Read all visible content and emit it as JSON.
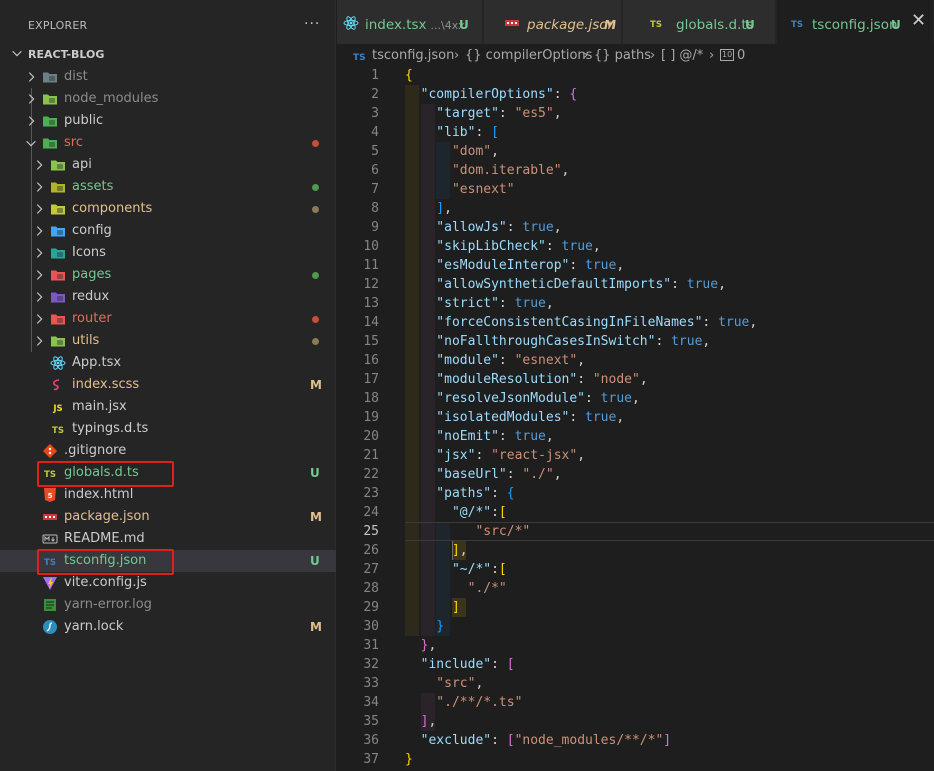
{
  "explorer": {
    "title": "EXPLORER",
    "more": "···",
    "root": "REACT-BLOG",
    "items": [
      {
        "label": "dist",
        "depth": 0,
        "type": "folder",
        "open": false,
        "icon": "dist-folder-icon",
        "icolor": "#6d8086",
        "tcolor": "#8c8c8c"
      },
      {
        "label": "node_modules",
        "depth": 0,
        "type": "folder",
        "open": false,
        "icon": "node-folder-icon",
        "icolor": "#8bc34a",
        "tcolor": "#8c8c8c"
      },
      {
        "label": "public",
        "depth": 0,
        "type": "folder",
        "open": false,
        "icon": "public-folder-icon",
        "icolor": "#4caf50",
        "tcolor": "#cccccc"
      },
      {
        "label": "src",
        "depth": 0,
        "type": "folder",
        "open": true,
        "icon": "src-folder-icon",
        "icolor": "#4caf50",
        "tcolor": "#e06c5f",
        "dot": "#c74e39"
      },
      {
        "label": "api",
        "depth": 1,
        "type": "folder",
        "open": false,
        "icon": "api-folder-icon",
        "icolor": "#8bc34a",
        "tcolor": "#cccccc"
      },
      {
        "label": "assets",
        "depth": 1,
        "type": "folder",
        "open": false,
        "icon": "assets-folder-icon",
        "icolor": "#afb42b",
        "tcolor": "#73c991",
        "dot": "#4e9a4e"
      },
      {
        "label": "components",
        "depth": 1,
        "type": "folder",
        "open": false,
        "icon": "components-folder-icon",
        "icolor": "#c0ca33",
        "tcolor": "#e2c08d",
        "dot": "#8a7a55"
      },
      {
        "label": "config",
        "depth": 1,
        "type": "folder",
        "open": false,
        "icon": "config-folder-icon",
        "icolor": "#42a5f5",
        "tcolor": "#cccccc"
      },
      {
        "label": "Icons",
        "depth": 1,
        "type": "folder",
        "open": false,
        "icon": "icons-folder-icon",
        "icolor": "#26a69a",
        "tcolor": "#cccccc"
      },
      {
        "label": "pages",
        "depth": 1,
        "type": "folder",
        "open": false,
        "icon": "pages-folder-icon",
        "icolor": "#ef5350",
        "tcolor": "#73c991",
        "dot": "#4e9a4e"
      },
      {
        "label": "redux",
        "depth": 1,
        "type": "folder",
        "open": false,
        "icon": "redux-folder-icon",
        "icolor": "#7e57c2",
        "tcolor": "#cccccc"
      },
      {
        "label": "router",
        "depth": 1,
        "type": "folder",
        "open": false,
        "icon": "router-folder-icon",
        "icolor": "#ef5350",
        "tcolor": "#e06c5f",
        "dot": "#c74e39"
      },
      {
        "label": "utils",
        "depth": 1,
        "type": "folder",
        "open": false,
        "icon": "utils-folder-icon",
        "icolor": "#8bc34a",
        "tcolor": "#e2c08d",
        "dot": "#8a7a55"
      },
      {
        "label": "App.tsx",
        "depth": 1,
        "type": "file",
        "icon": "react-icon",
        "icolor": "#61dafb",
        "tcolor": "#cccccc"
      },
      {
        "label": "index.scss",
        "depth": 1,
        "type": "file",
        "icon": "sass-icon",
        "icolor": "#ec407a",
        "tcolor": "#e2c08d",
        "badge": "M",
        "bcolor": "#e2c08d"
      },
      {
        "label": "main.jsx",
        "depth": 1,
        "type": "file",
        "icon": "js-icon",
        "text": "JS",
        "icolor": "#f5de19",
        "tcolor": "#cccccc"
      },
      {
        "label": "typings.d.ts",
        "depth": 1,
        "type": "file",
        "icon": "ts-icon",
        "text": "TS",
        "icolor": "#c0ca33",
        "tcolor": "#cccccc"
      },
      {
        "label": ".gitignore",
        "depth": 0,
        "type": "file",
        "icon": "git-icon",
        "icolor": "#e64a19",
        "tcolor": "#cccccc"
      },
      {
        "label": "globals.d.ts",
        "depth": 0,
        "type": "file",
        "icon": "ts-icon",
        "text": "TS",
        "icolor": "#c0ca33",
        "tcolor": "#73c991",
        "badge": "U",
        "bcolor": "#73c991"
      },
      {
        "label": "index.html",
        "depth": 0,
        "type": "file",
        "icon": "html-icon",
        "icolor": "#e44d26",
        "tcolor": "#cccccc"
      },
      {
        "label": "package.json",
        "depth": 0,
        "type": "file",
        "icon": "npm-icon",
        "icolor": "#cb3837",
        "tcolor": "#e2c08d",
        "badge": "M",
        "bcolor": "#e2c08d"
      },
      {
        "label": "README.md",
        "depth": 0,
        "type": "file",
        "icon": "markdown-icon",
        "icolor": "#bbbbbb",
        "tcolor": "#cccccc"
      },
      {
        "label": "tsconfig.json",
        "depth": 0,
        "type": "file",
        "icon": "tsconfig-icon",
        "text": "TS",
        "icolor": "#3b82c4",
        "tcolor": "#73c991",
        "badge": "U",
        "bcolor": "#73c991",
        "selected": true
      },
      {
        "label": "vite.config.js",
        "depth": 0,
        "type": "file",
        "icon": "vite-icon",
        "icolor": "#a46bff",
        "tcolor": "#cccccc"
      },
      {
        "label": "yarn-error.log",
        "depth": 0,
        "type": "file",
        "icon": "log-icon",
        "icolor": "#3a8f3a",
        "tcolor": "#8c8c8c"
      },
      {
        "label": "yarn.lock",
        "depth": 0,
        "type": "file",
        "icon": "yarn-icon",
        "icolor": "#2c8ebb",
        "tcolor": "#cccccc",
        "badge": "M",
        "bcolor": "#e2c08d"
      }
    ]
  },
  "tabs": [
    {
      "label": "index.tsx",
      "desc": "...\\4xx",
      "status": "U",
      "icon": "react-icon",
      "active": false,
      "italic": false,
      "lcolor": "#73c991",
      "scolor": "#73c991"
    },
    {
      "label": "package.json",
      "desc": "",
      "status": "M",
      "icon": "npm-icon",
      "active": false,
      "italic": true,
      "lcolor": "#e2c08d",
      "scolor": "#e2c08d"
    },
    {
      "label": "globals.d.ts",
      "desc": "",
      "status": "U",
      "icon": "ts-icon",
      "active": false,
      "italic": false,
      "lcolor": "#73c991",
      "scolor": "#73c991"
    },
    {
      "label": "tsconfig.json",
      "desc": "",
      "status": "U",
      "icon": "tsconfig-icon",
      "active": true,
      "italic": false,
      "lcolor": "#73c991",
      "scolor": "#73c991",
      "close": "✕"
    }
  ],
  "breadcrumb": {
    "file": "tsconfig.json",
    "sep": "›",
    "obj1": "{} compilerOptions",
    "obj2": "{} paths",
    "arr": "[ ] @/*",
    "num": "0"
  },
  "editor": {
    "current_line": 25,
    "lines": [
      [
        [
          "br1",
          "{"
        ]
      ],
      [
        [
          "k",
          "  \"compilerOptions\""
        ],
        [
          "p",
          ": "
        ],
        [
          "br2",
          "{"
        ]
      ],
      [
        [
          "k",
          "    \"target\""
        ],
        [
          "p",
          ": "
        ],
        [
          "s",
          "\"es5\""
        ],
        [
          "p",
          ","
        ]
      ],
      [
        [
          "k",
          "    \"lib\""
        ],
        [
          "p",
          ": "
        ],
        [
          "br3",
          "["
        ]
      ],
      [
        [
          "s",
          "      \"dom\""
        ],
        [
          "p",
          ","
        ]
      ],
      [
        [
          "s",
          "      \"dom.iterable\""
        ],
        [
          "p",
          ","
        ]
      ],
      [
        [
          "s",
          "      \"esnext\""
        ]
      ],
      [
        [
          "br3",
          "    ]"
        ],
        [
          "p",
          ","
        ]
      ],
      [
        [
          "k",
          "    \"allowJs\""
        ],
        [
          "p",
          ": "
        ],
        [
          "b",
          "true"
        ],
        [
          "p",
          ","
        ]
      ],
      [
        [
          "k",
          "    \"skipLibCheck\""
        ],
        [
          "p",
          ": "
        ],
        [
          "b",
          "true"
        ],
        [
          "p",
          ","
        ]
      ],
      [
        [
          "k",
          "    \"esModuleInterop\""
        ],
        [
          "p",
          ": "
        ],
        [
          "b",
          "true"
        ],
        [
          "p",
          ","
        ]
      ],
      [
        [
          "k",
          "    \"allowSyntheticDefaultImports\""
        ],
        [
          "p",
          ": "
        ],
        [
          "b",
          "true"
        ],
        [
          "p",
          ","
        ]
      ],
      [
        [
          "k",
          "    \"strict\""
        ],
        [
          "p",
          ": "
        ],
        [
          "b",
          "true"
        ],
        [
          "p",
          ","
        ]
      ],
      [
        [
          "k",
          "    \"forceConsistentCasingInFileNames\""
        ],
        [
          "p",
          ": "
        ],
        [
          "b",
          "true"
        ],
        [
          "p",
          ","
        ]
      ],
      [
        [
          "k",
          "    \"noFallthroughCasesInSwitch\""
        ],
        [
          "p",
          ": "
        ],
        [
          "b",
          "true"
        ],
        [
          "p",
          ","
        ]
      ],
      [
        [
          "k",
          "    \"module\""
        ],
        [
          "p",
          ": "
        ],
        [
          "s",
          "\"esnext\""
        ],
        [
          "p",
          ","
        ]
      ],
      [
        [
          "k",
          "    \"moduleResolution\""
        ],
        [
          "p",
          ": "
        ],
        [
          "s",
          "\"node\""
        ],
        [
          "p",
          ","
        ]
      ],
      [
        [
          "k",
          "    \"resolveJsonModule\""
        ],
        [
          "p",
          ": "
        ],
        [
          "b",
          "true"
        ],
        [
          "p",
          ","
        ]
      ],
      [
        [
          "k",
          "    \"isolatedModules\""
        ],
        [
          "p",
          ": "
        ],
        [
          "b",
          "true"
        ],
        [
          "p",
          ","
        ]
      ],
      [
        [
          "k",
          "    \"noEmit\""
        ],
        [
          "p",
          ": "
        ],
        [
          "b",
          "true"
        ],
        [
          "p",
          ","
        ]
      ],
      [
        [
          "k",
          "    \"jsx\""
        ],
        [
          "p",
          ": "
        ],
        [
          "s",
          "\"react-jsx\""
        ],
        [
          "p",
          ","
        ]
      ],
      [
        [
          "k",
          "    \"baseUrl\""
        ],
        [
          "p",
          ": "
        ],
        [
          "s",
          "\"./\""
        ],
        [
          "p",
          ","
        ]
      ],
      [
        [
          "k",
          "    \"paths\""
        ],
        [
          "p",
          ": "
        ],
        [
          "br3",
          "{"
        ]
      ],
      [
        [
          "k",
          "      \"@/*\""
        ],
        [
          "p",
          ":"
        ],
        [
          "br1",
          "["
        ]
      ],
      [
        [
          "s",
          "         \"src/*\""
        ]
      ],
      [
        [
          "br1",
          "      ]"
        ],
        [
          "p",
          ","
        ]
      ],
      [
        [
          "k",
          "      \"~/*\""
        ],
        [
          "p",
          ":"
        ],
        [
          "br1",
          "["
        ]
      ],
      [
        [
          "s",
          "        \"./*\""
        ]
      ],
      [
        [
          "br1",
          "      ]"
        ]
      ],
      [
        [
          "br3",
          "    }"
        ]
      ],
      [
        [
          "br2",
          "  }"
        ],
        [
          "p",
          ","
        ]
      ],
      [
        [
          "k",
          "  \"include\""
        ],
        [
          "p",
          ": "
        ],
        [
          "br2",
          "["
        ]
      ],
      [
        [
          "s",
          "    \"src\""
        ],
        [
          "p",
          ","
        ]
      ],
      [
        [
          "s",
          "    \"./**/*.ts\""
        ]
      ],
      [
        [
          "br2",
          "  ]"
        ],
        [
          "p",
          ","
        ]
      ],
      [
        [
          "k",
          "  \"exclude\""
        ],
        [
          "p",
          ": "
        ],
        [
          "br2",
          "["
        ],
        [
          "s",
          "\"node_modules/**/*\""
        ],
        [
          "br2",
          "]"
        ]
      ],
      [
        [
          "br1",
          "}"
        ]
      ]
    ]
  }
}
